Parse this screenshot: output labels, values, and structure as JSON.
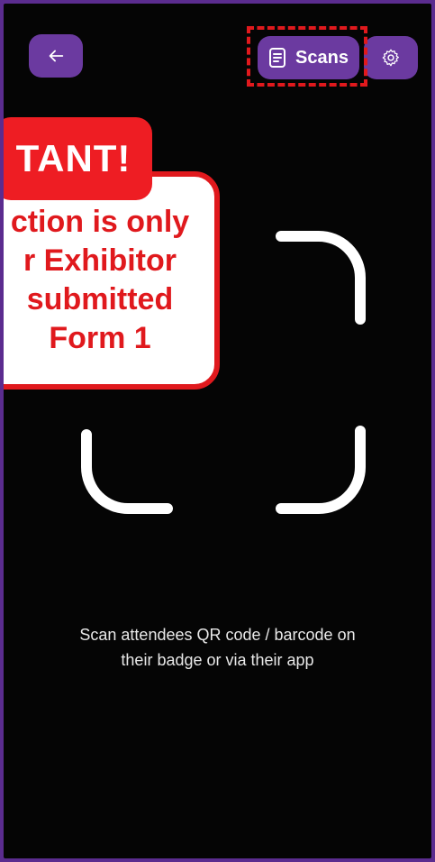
{
  "header": {
    "back_icon": "arrow-left-icon",
    "scans_label": "Scans",
    "scans_icon": "document-icon",
    "settings_icon": "gear-icon"
  },
  "callout": {
    "tag_text": "TANT!",
    "body_text": "ction is only\nr Exhibitor\nsubmitted\nForm 1"
  },
  "scanner": {
    "instructions": "Scan attendees QR code / barcode on\ntheir badge or via their app"
  },
  "colors": {
    "brand_purple": "#6b3aa0",
    "alert_red": "#e0191d",
    "background": "#050505"
  }
}
